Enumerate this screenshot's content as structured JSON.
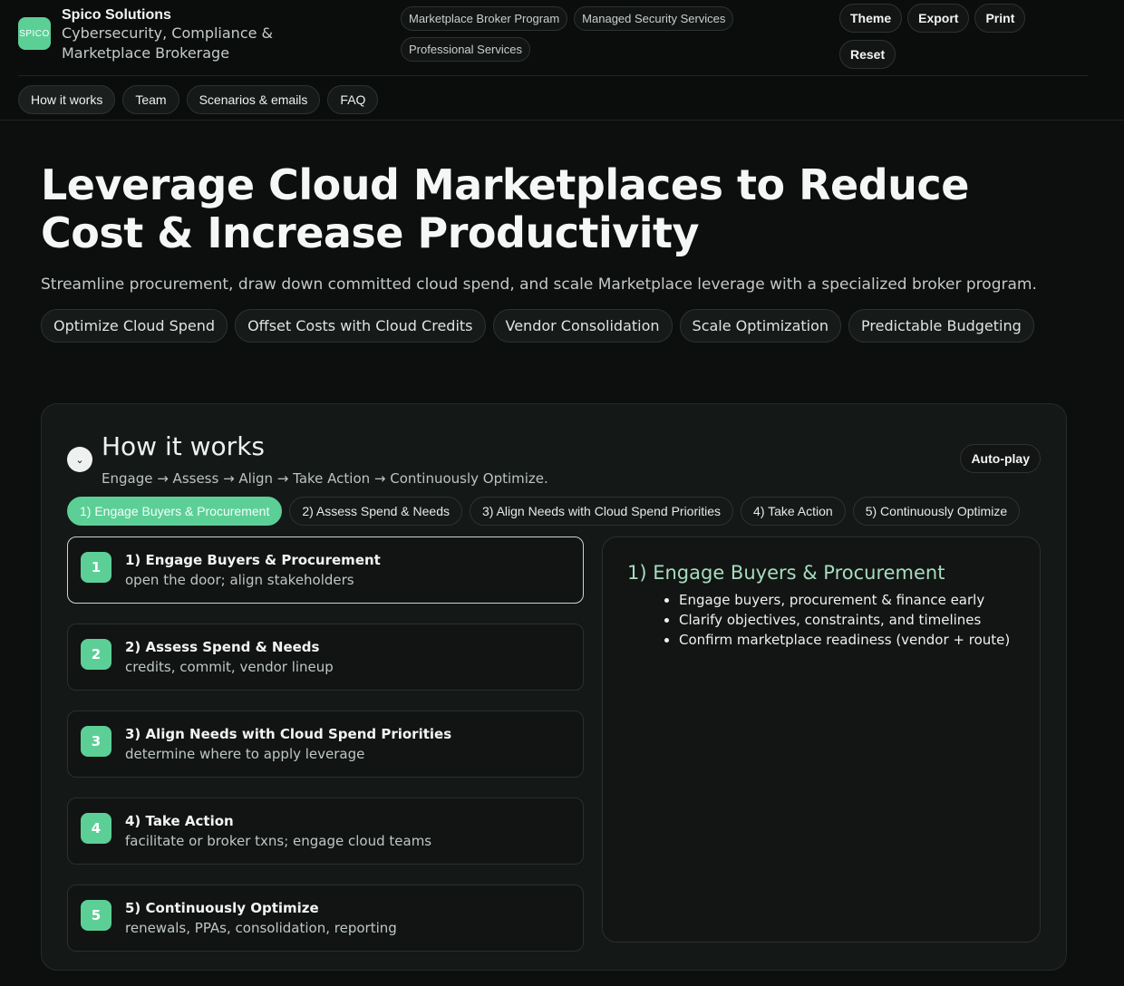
{
  "brand": {
    "logo_text": "SPICO",
    "name": "Spico Solutions",
    "tagline": "Cybersecurity, Compliance & Marketplace Brokerage"
  },
  "services": [
    "Marketplace Broker Program",
    "Managed Security Services",
    "Professional Services"
  ],
  "actions": {
    "theme": "Theme",
    "export": "Export",
    "print": "Print",
    "reset": "Reset"
  },
  "nav": [
    "How it works",
    "Team",
    "Scenarios & emails",
    "FAQ"
  ],
  "hero": {
    "title": "Leverage Cloud Marketplaces to Reduce Cost & Increase Productivity",
    "subtitle": "Streamline procurement, draw down committed cloud spend, and scale Marketplace leverage with a specialized broker program.",
    "pills": [
      "Optimize Cloud Spend",
      "Offset Costs with Cloud Credits",
      "Vendor Consolidation",
      "Scale Optimization",
      "Predictable Budgeting"
    ]
  },
  "how": {
    "collapse_glyph": "⌄",
    "title": "How it works",
    "subtitle": "Engage → Assess → Align → Take Action → Continuously Optimize.",
    "autoplay": "Auto-play",
    "tabs": [
      "1) Engage Buyers & Procurement",
      "2) Assess Spend & Needs",
      "3) Align Needs with Cloud Spend Priorities",
      "4) Take Action",
      "5) Continuously Optimize"
    ],
    "steps": [
      {
        "num": "1",
        "title": "1) Engage Buyers & Procurement",
        "desc": "open the door; align stakeholders"
      },
      {
        "num": "2",
        "title": "2) Assess Spend & Needs",
        "desc": "credits, commit, vendor lineup"
      },
      {
        "num": "3",
        "title": "3) Align Needs with Cloud Spend Priorities",
        "desc": "determine where to apply leverage"
      },
      {
        "num": "4",
        "title": "4) Take Action",
        "desc": "facilitate or broker txns; engage cloud teams"
      },
      {
        "num": "5",
        "title": "5) Continuously Optimize",
        "desc": "renewals, PPAs, consolidation, reporting"
      }
    ],
    "detail": {
      "title": "1) Engage Buyers & Procurement",
      "bullets": [
        "Engage buyers, procurement & finance early",
        "Clarify objectives, constraints, and timelines",
        "Confirm marketplace readiness (vendor + route)"
      ]
    }
  },
  "colors": {
    "accent": "#5ccf96",
    "background": "#0d0f0e",
    "panel": "#141816"
  }
}
